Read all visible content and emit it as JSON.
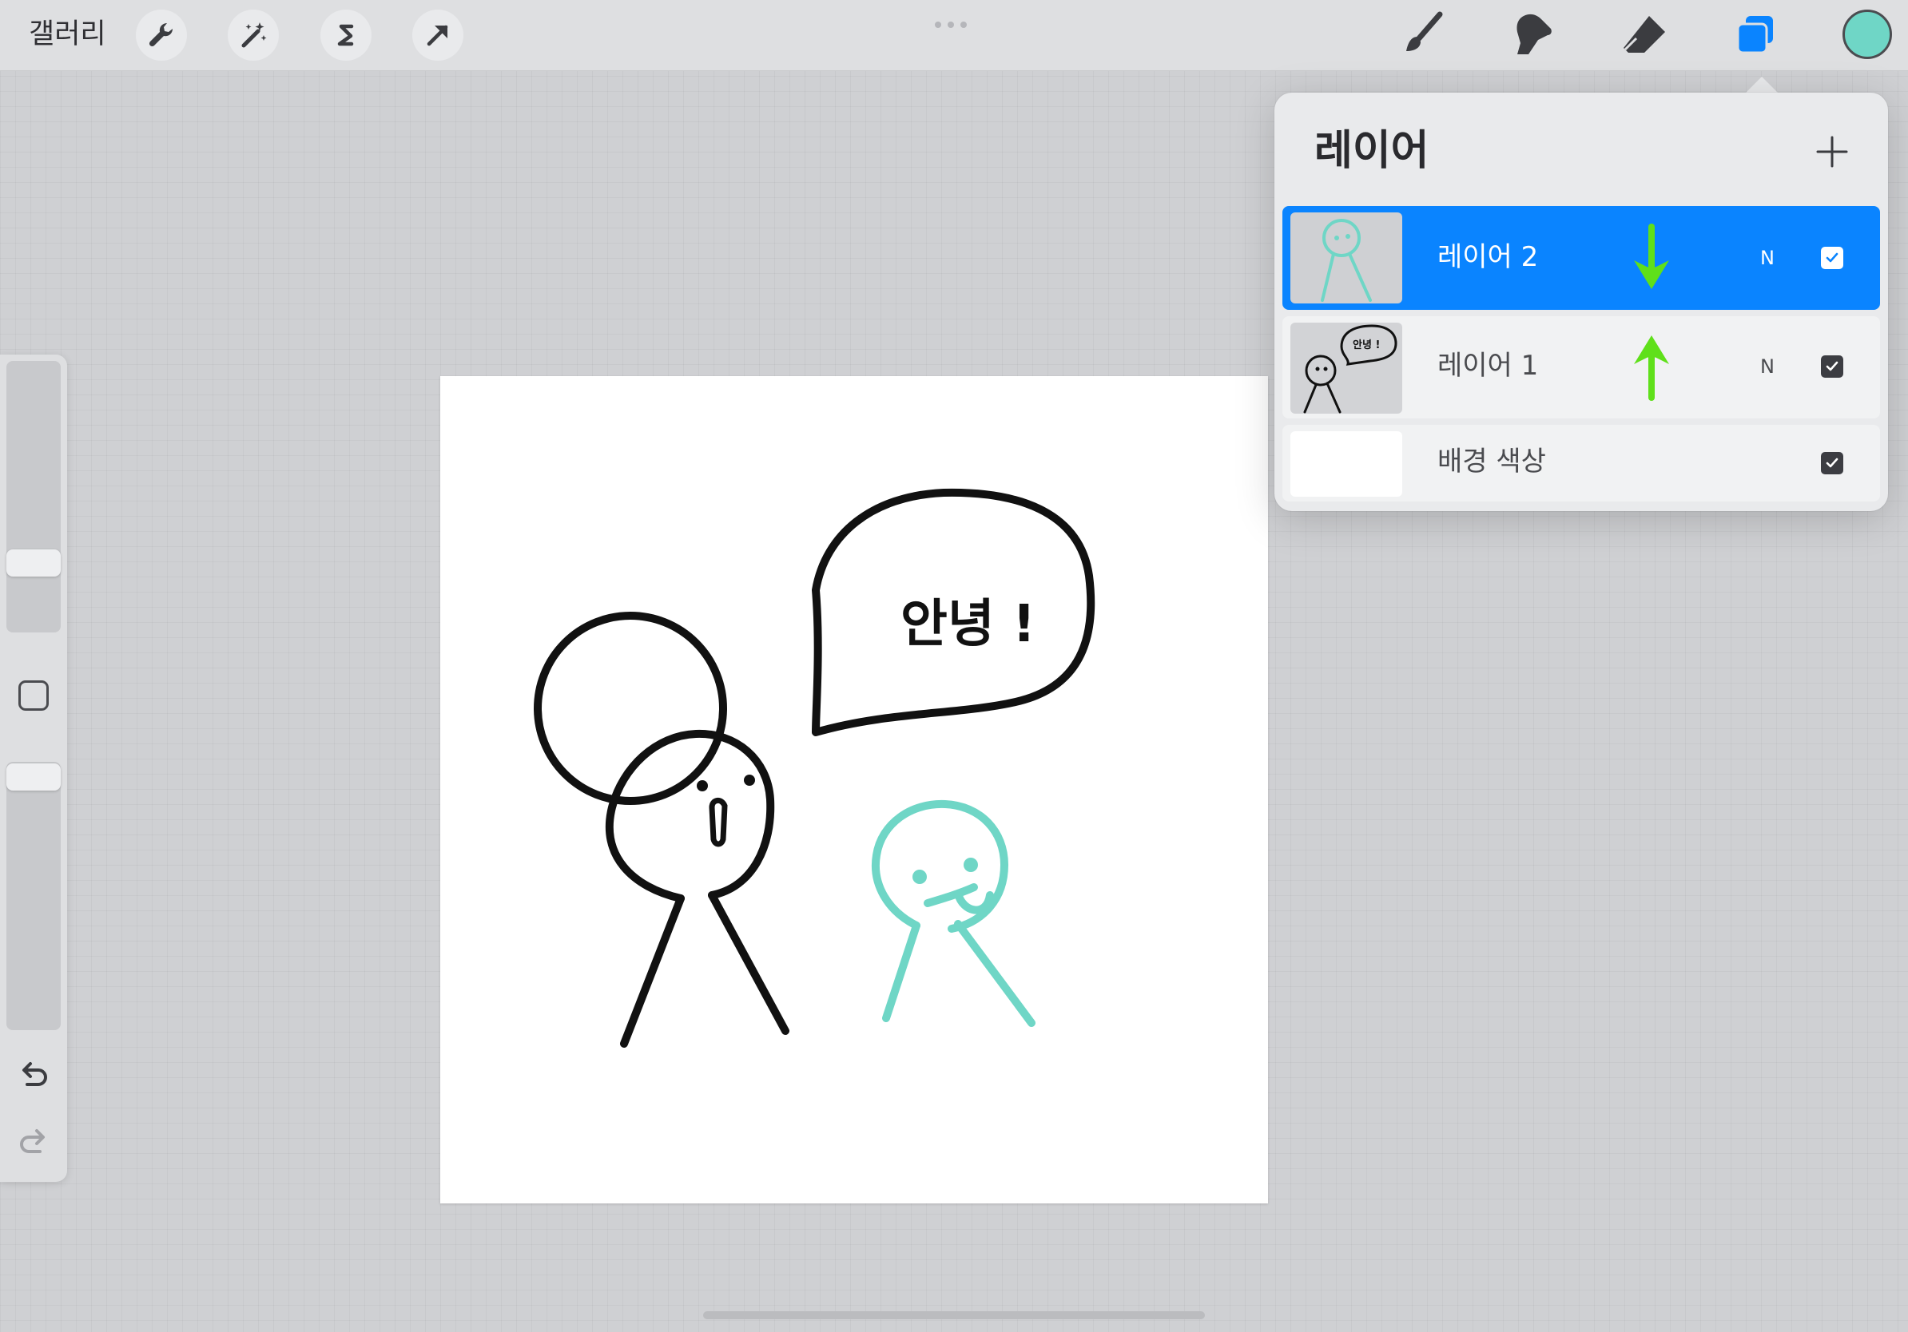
{
  "top_bar": {
    "gallery_label": "갤러리",
    "left_tools": [
      "wrench-icon",
      "magic-wand-icon",
      "selection-s-icon",
      "transform-arrow-icon"
    ],
    "right_tools": [
      "brush-icon",
      "smudge-icon",
      "eraser-icon",
      "layers-icon"
    ],
    "current_color": "#6fd6c6"
  },
  "canvas": {
    "speech_text": "안녕 !",
    "stroke_black": "#111111",
    "stroke_teal": "#6fd6c6"
  },
  "layers_panel": {
    "title": "레이어",
    "add_icon": "plus-icon",
    "layers": [
      {
        "name": "레이어 2",
        "blend": "N",
        "visible": true,
        "selected": true,
        "annotation": "arrow-down"
      },
      {
        "name": "레이어 1",
        "blend": "N",
        "visible": true,
        "selected": false,
        "annotation": "arrow-up"
      },
      {
        "name": "배경 색상",
        "blend": "",
        "visible": true,
        "selected": false
      }
    ]
  },
  "colors": {
    "accent": "#0a84ff",
    "annotation_green": "#5fe01a",
    "toolbar_bg": "#dedfe1",
    "panel_bg": "#e9eaec"
  }
}
